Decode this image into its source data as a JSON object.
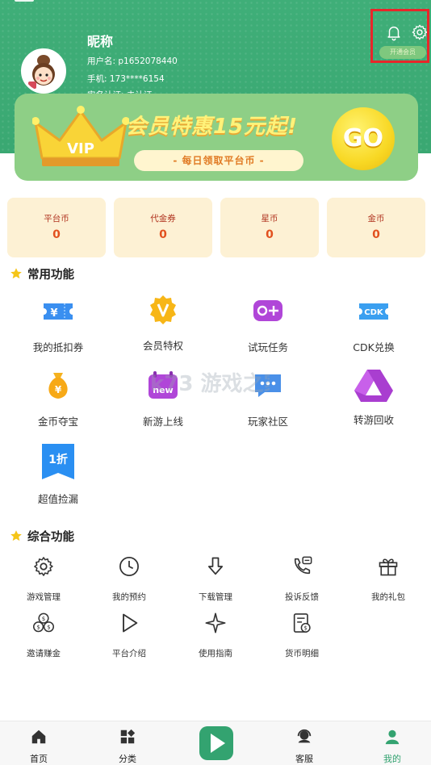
{
  "profile": {
    "nickname": "昵称",
    "username": "用户名: p1652078440",
    "phone": "手机: 173****6154",
    "realname": "实名认证: 未认证",
    "pill_label": "开通会员"
  },
  "header_icons": [
    "bell-icon",
    "gear-icon"
  ],
  "banner": {
    "title": "会员特惠15元起!",
    "subtitle": "- 每日领取平台币 -",
    "go_label": "GO",
    "vip_label": "VIP"
  },
  "wallet": [
    {
      "label": "平台币",
      "value": "0"
    },
    {
      "label": "代金券",
      "value": "0"
    },
    {
      "label": "星币",
      "value": "0"
    },
    {
      "label": "金币",
      "value": "0"
    }
  ],
  "common": {
    "title": "常用功能",
    "items": [
      {
        "label": "我的抵扣券",
        "icon": "ticket-icon"
      },
      {
        "label": "会员特权",
        "icon": "vip-badge-icon"
      },
      {
        "label": "试玩任务",
        "icon": "gamepad-icon"
      },
      {
        "label": "CDK兑换",
        "icon": "cdk-icon",
        "icon_text": "CDK"
      },
      {
        "label": "金币夺宝",
        "icon": "money-bag-icon"
      },
      {
        "label": "新游上线",
        "icon": "new-game-icon",
        "icon_text": "new"
      },
      {
        "label": "玩家社区",
        "icon": "chat-icon"
      },
      {
        "label": "转游回收",
        "icon": "recycle-triangle-icon"
      },
      {
        "label": "超值捡漏",
        "icon": "discount-tag-icon",
        "icon_text": "1折"
      }
    ]
  },
  "tools": {
    "title": "综合功能",
    "items": [
      {
        "label": "游戏管理",
        "icon": "gear-icon"
      },
      {
        "label": "我的预约",
        "icon": "clock-icon"
      },
      {
        "label": "下载管理",
        "icon": "download-icon"
      },
      {
        "label": "投诉反馈",
        "icon": "phone-feedback-icon"
      },
      {
        "label": "我的礼包",
        "icon": "gift-icon"
      },
      {
        "label": "邀请赚金",
        "icon": "coins-icon"
      },
      {
        "label": "平台介绍",
        "icon": "play-outline-icon"
      },
      {
        "label": "使用指南",
        "icon": "sparkle-icon"
      },
      {
        "label": "货币明细",
        "icon": "bill-icon"
      }
    ]
  },
  "watermark": {
    "text": "k73 游戏之家 .com"
  },
  "nav": [
    {
      "label": "首页",
      "icon": "home-icon"
    },
    {
      "label": "分类",
      "icon": "category-icon"
    },
    {
      "label": "客服",
      "icon": "customer-service-icon"
    },
    {
      "label": "我的",
      "icon": "profile-icon",
      "active": true
    }
  ],
  "colors": {
    "brand_green": "#3aa872",
    "accent_orange": "#e2511f",
    "card_bg": "#fdf1d4"
  }
}
